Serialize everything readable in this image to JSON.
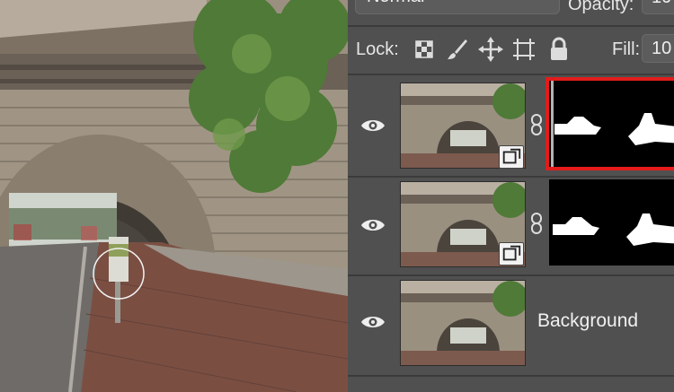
{
  "canvas": {
    "description_icon": "photo-canvas"
  },
  "panel": {
    "blend_mode": "Normal",
    "opacity_label": "Opacity:",
    "opacity_value": "10",
    "lock_label": "Lock:",
    "lock_icons": [
      "lock-transparent-pixels-icon",
      "lock-image-pixels-icon",
      "lock-position-icon",
      "lock-artboard-icon",
      "lock-all-icon"
    ],
    "fill_label": "Fill:",
    "fill_value": "10",
    "layers": [
      {
        "name": "",
        "visible": true,
        "smart_object": true,
        "mask": true,
        "mask_selected": true
      },
      {
        "name": "",
        "visible": true,
        "smart_object": true,
        "mask": true,
        "mask_selected": false
      },
      {
        "name": "Background",
        "visible": true,
        "smart_object": false,
        "mask": false,
        "mask_selected": false
      }
    ]
  },
  "colors": {
    "panel_bg": "#505050",
    "selection": "#e31b1b",
    "mask_white": "#ffffff",
    "mask_black": "#000000"
  }
}
